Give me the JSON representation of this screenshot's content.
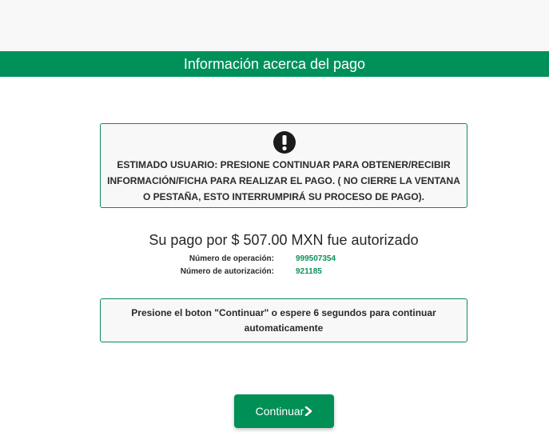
{
  "header": {
    "title": "Información acerca del pago"
  },
  "alert": {
    "icon": "exclamation-icon",
    "message": "ESTIMADO USUARIO: PRESIONE CONTINUAR PARA OBTENER/RECIBIR INFORMACIÓN/FICHA PARA REALIZAR EL PAGO. ( NO CIERRE LA VENTANA O PESTAÑA, ESTO INTERRUMPIRÁ SU PROCESO DE PAGO)."
  },
  "payment": {
    "summary": "Su pago por $ 507.00 MXN fue autorizado",
    "operation_label": "Número de operación:",
    "operation_value": "999507354",
    "authorization_label": "Número de autorización:",
    "authorization_value": "921185"
  },
  "info": {
    "message": "Presione el boton \"Continuar\" o espere 6 segundos para continuar automaticamente"
  },
  "actions": {
    "continue_label": "Continuar",
    "continue_icon": "chevron-right-icon"
  },
  "colors": {
    "brand_green": "#00905a",
    "value_green": "#0f8f5b",
    "panel_background": "#f8f8f8"
  }
}
